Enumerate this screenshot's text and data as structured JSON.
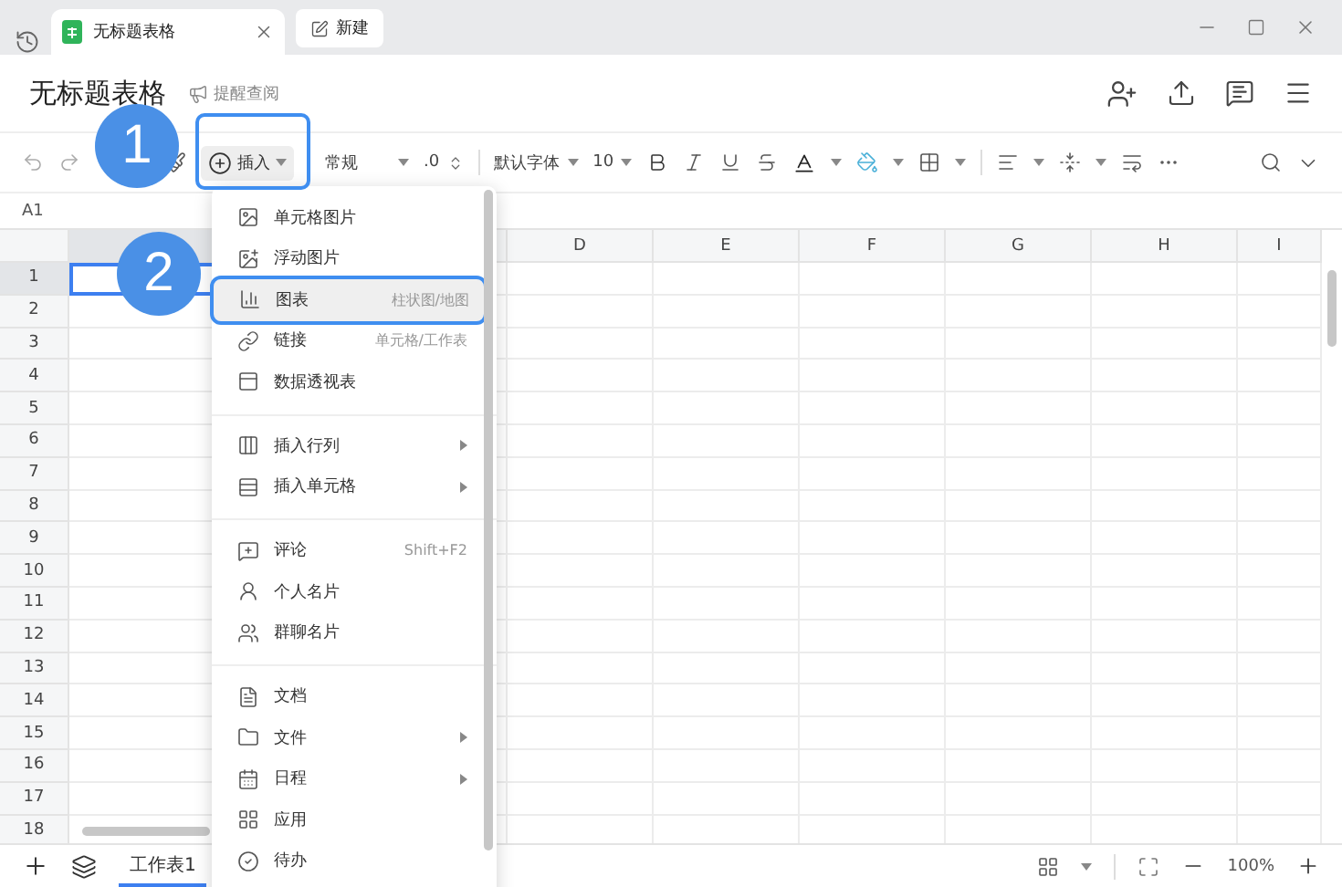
{
  "tabs": [
    {
      "label": "无标题表格",
      "kind": "doc",
      "selected": true
    },
    {
      "label": "新建",
      "kind": "new",
      "selected": false
    }
  ],
  "header": {
    "title": "无标题表格",
    "remind": "提醒查阅"
  },
  "toolbar": {
    "insert": "插入",
    "number_format": "常规",
    "decimal": ".0",
    "font": "默认字体",
    "font_size": "10"
  },
  "cell_ref": "A1",
  "columns": [
    "D",
    "E",
    "F",
    "G",
    "H",
    "I"
  ],
  "rows": [
    {
      "label": "1",
      "selected": true
    },
    {
      "label": "2",
      "selected": false
    },
    {
      "label": "3",
      "selected": false
    },
    {
      "label": "4",
      "selected": false
    },
    {
      "label": "5",
      "selected": false
    },
    {
      "label": "6",
      "selected": false
    },
    {
      "label": "7",
      "selected": false
    },
    {
      "label": "8",
      "selected": false
    },
    {
      "label": "9",
      "selected": false
    },
    {
      "label": "10",
      "selected": false
    },
    {
      "label": "11",
      "selected": false
    },
    {
      "label": "12",
      "selected": false
    },
    {
      "label": "13",
      "selected": false
    },
    {
      "label": "14",
      "selected": false
    },
    {
      "label": "15",
      "selected": false
    },
    {
      "label": "16",
      "selected": false
    },
    {
      "label": "17",
      "selected": false
    },
    {
      "label": "18",
      "selected": false
    }
  ],
  "menu": [
    [
      {
        "label": "单元格图片",
        "selected": false,
        "submenu": false
      },
      {
        "label": "浮动图片",
        "selected": false,
        "submenu": false
      },
      {
        "label": "图表",
        "hint": "柱状图/地图",
        "selected": true,
        "submenu": false
      },
      {
        "label": "链接",
        "hint": "单元格/工作表",
        "selected": false,
        "submenu": false
      },
      {
        "label": "数据透视表",
        "selected": false,
        "submenu": false
      }
    ],
    [
      {
        "label": "插入行列",
        "selected": false,
        "submenu": true
      },
      {
        "label": "插入单元格",
        "selected": false,
        "submenu": true
      }
    ],
    [
      {
        "label": "评论",
        "hint": "Shift+F2",
        "selected": false,
        "submenu": false
      },
      {
        "label": "个人名片",
        "selected": false,
        "submenu": false
      },
      {
        "label": "群聊名片",
        "selected": false,
        "submenu": false
      }
    ],
    [
      {
        "label": "文档",
        "selected": false,
        "submenu": false
      },
      {
        "label": "文件",
        "selected": false,
        "submenu": true
      },
      {
        "label": "日程",
        "selected": false,
        "submenu": true
      },
      {
        "label": "应用",
        "selected": false,
        "submenu": false
      },
      {
        "label": "待办",
        "selected": false,
        "submenu": false
      }
    ]
  ],
  "callouts": [
    "1",
    "2"
  ],
  "sheets": [
    {
      "label": "工作表1",
      "selected": true
    }
  ],
  "zoom": "100%"
}
